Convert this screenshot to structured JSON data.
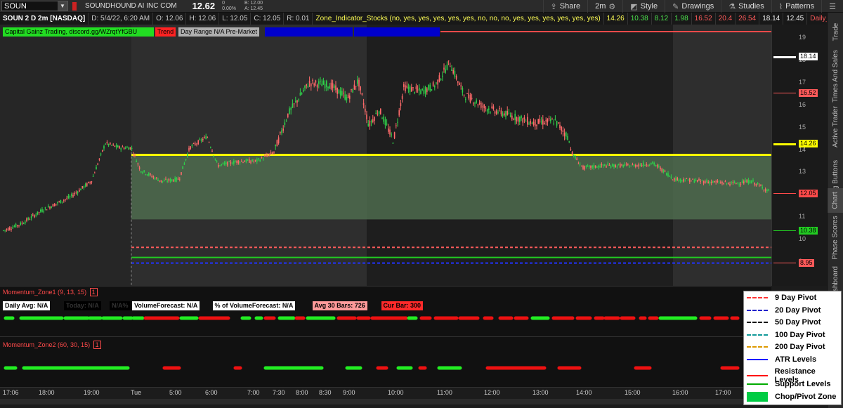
{
  "header": {
    "symbol": "SOUN",
    "company": "SOUNDHOUND AI INC COM",
    "last": "12.62",
    "change": "0",
    "change_pct": "0.00%",
    "bid": "B: 12.00",
    "ask": "A: 12.45",
    "timeframe": "2m",
    "tools": [
      "Share",
      "Style",
      "Drawings",
      "Studies",
      "Patterns"
    ]
  },
  "status": {
    "title": "SOUN 2 D 2m [NASDAQ]",
    "date": "D: 5/4/22, 6:20 AM",
    "open": "O: 12.06",
    "high": "H: 12.06",
    "low": "L: 12.05",
    "close": "C: 12.05",
    "range": "R: 0.01",
    "indicator": "Zone_Indicator_Stocks (no, yes, yes, yes, yes, yes, no, no, no, yes, yes, yes, yes, yes, yes)",
    "vals": [
      "14.26",
      "10.38",
      "8.12",
      "1.98",
      "16.52",
      "20.4",
      "26.54",
      "18.14",
      "12.45",
      "Daily_Pivot ..."
    ],
    "val_colors": [
      "#ffff55",
      "#4ce04c",
      "#4ce04c",
      "#4ce04c",
      "#ff5a5a",
      "#ff5a5a",
      "#ff5a5a",
      "#eeeeee",
      "#eeeeee",
      "#ff5a5a"
    ]
  },
  "labels": {
    "discord": "Capital Gainz Trading, discord.gg/WZrqtYfGBU",
    "trend": "Trend",
    "dayrange": "Day Range N/A Pre-Market",
    "blue1": "...",
    "blue2": "..."
  },
  "price_axis": {
    "ticks": [
      "19",
      "18",
      "17",
      "16",
      "15",
      "14",
      "13",
      "12",
      "11",
      "10",
      "9"
    ],
    "markers": [
      {
        "text": "18.14",
        "bg": "#ffffff",
        "fg": "#000000"
      },
      {
        "text": "16.52",
        "bg": "#ff5a5a",
        "fg": "#000000"
      },
      {
        "text": "14.26",
        "bg": "#ffff00",
        "fg": "#000000"
      },
      {
        "text": "12.05",
        "bg": "#ff4a4a",
        "fg": "#000000"
      },
      {
        "text": "10.38",
        "bg": "#22cc22",
        "fg": "#000000"
      },
      {
        "text": "8.95",
        "bg": "#ff5a5a",
        "fg": "#000000"
      }
    ]
  },
  "study1": {
    "name": "Momentum_Zone1 (9, 13, 15)",
    "num": "1",
    "pills": [
      {
        "text": "Daily Avg: N/A",
        "bg": "#ffffff",
        "fg": "#000000"
      },
      {
        "text": "Today: N/A",
        "bg": "#000000",
        "fg": "#333333"
      },
      {
        "text": "N/A%",
        "bg": "#000000",
        "fg": "#333333"
      },
      {
        "text": "VolumeForecast: N/A",
        "bg": "#ffffff",
        "fg": "#000000"
      },
      {
        "text": "% of VolumeForecast: N/A",
        "bg": "#ffffff",
        "fg": "#000000"
      },
      {
        "text": "Avg 30 Bars: 726",
        "bg": "#ff9a9a",
        "fg": "#000000"
      },
      {
        "text": "Cur Bar: 300",
        "bg": "#ff2a2a",
        "fg": "#000000"
      }
    ]
  },
  "study2": {
    "name": "Momentum_Zone2 (60, 30, 15)",
    "num": "1"
  },
  "time_axis": [
    "17:06",
    "18:00",
    "19:00",
    "Tue",
    "5:00",
    "6:00",
    "7:00",
    "7:30",
    "8:00",
    "8:30",
    "9:00",
    "10:00",
    "11:00",
    "12:00",
    "13:00",
    "14:00",
    "15:00",
    "16:00",
    "17:00"
  ],
  "legend": [
    {
      "label": "9 Day Pivot",
      "color": "#ff3333",
      "style": "dashed"
    },
    {
      "label": "20 Day Pivot",
      "color": "#2222cc",
      "style": "dashed"
    },
    {
      "label": "50 Day Pivot",
      "color": "#000000",
      "style": "dashed"
    },
    {
      "label": "100 Day Pivot",
      "color": "#119999",
      "style": "dashed"
    },
    {
      "label": "200 Day Pivot",
      "color": "#dd9900",
      "style": "dashed"
    },
    {
      "label": "ATR Levels",
      "color": "#0000ff",
      "style": "solid"
    },
    {
      "label": "Resistance Levels",
      "color": "#ff0000",
      "style": "solid"
    },
    {
      "label": "Support Levels",
      "color": "#00aa00",
      "style": "solid"
    },
    {
      "label": "Chop/Pivot Zone",
      "color": "#00cc44",
      "style": "box"
    }
  ],
  "sidebar": [
    "Trade",
    "Times And Sales",
    "Active Trader",
    "Big Buttons",
    "Chart",
    "Phase Scores",
    "Dashboard"
  ],
  "colors": {
    "bull": "#2fd04a",
    "bear": "#ff6a6a",
    "yellow": "#ffff00",
    "zone": "#4e6b4e"
  }
}
